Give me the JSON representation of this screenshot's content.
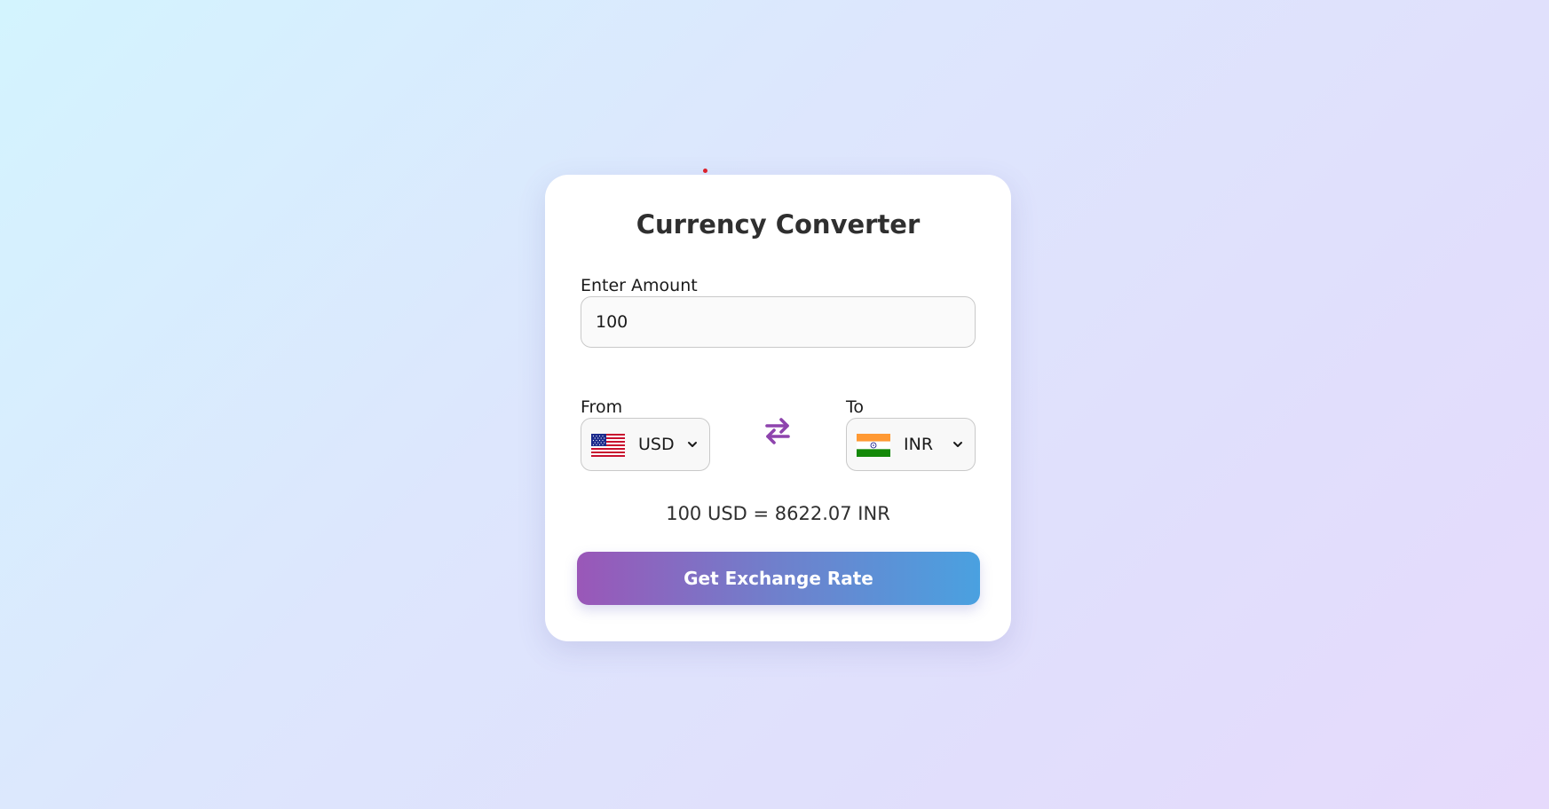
{
  "converter": {
    "title": "Currency Converter",
    "amount_label": "Enter Amount",
    "amount_value": "100",
    "from_label": "From",
    "to_label": "To",
    "from_currency": "USD",
    "to_currency": "INR",
    "from_flag_icon": "us-flag-icon",
    "to_flag_icon": "india-flag-icon",
    "swap_icon": "swap-arrows-icon",
    "result_text": "100 USD = 8622.07 INR",
    "button_label": "Get Exchange Rate"
  },
  "colors": {
    "accent_purple": "#8e44ad",
    "button_gradient_start": "#9a57b8",
    "button_gradient_end": "#4aa1e0",
    "card_background": "#ffffff"
  }
}
